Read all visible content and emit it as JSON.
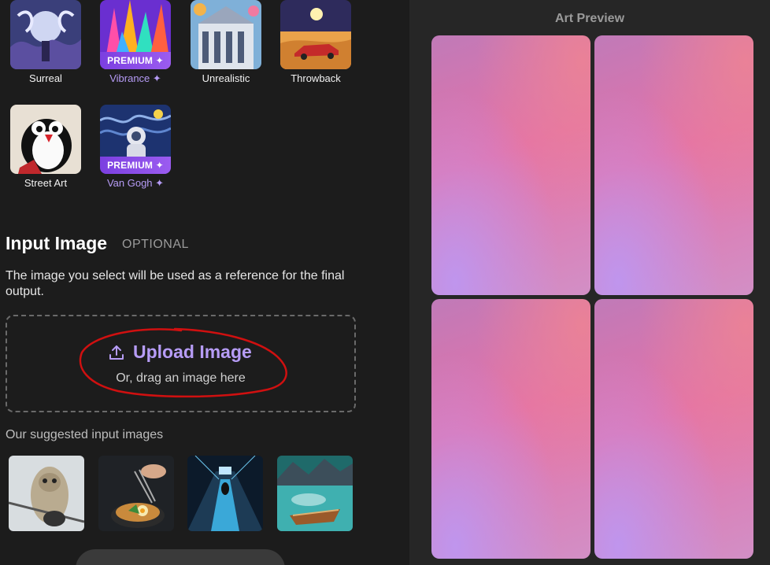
{
  "styles": [
    {
      "label": "Surreal",
      "premium": false,
      "icon": "surreal-art-thumbnail"
    },
    {
      "label": "Vibrance ✦",
      "premium": true,
      "badge": "PREMIUM ✦",
      "icon": "vibrance-art-thumbnail"
    },
    {
      "label": "Unrealistic",
      "premium": false,
      "icon": "unrealistic-art-thumbnail"
    },
    {
      "label": "Throwback",
      "premium": false,
      "icon": "throwback-art-thumbnail"
    },
    {
      "label": "Street Art",
      "premium": false,
      "icon": "street-art-thumbnail"
    },
    {
      "label": "Van Gogh ✦",
      "premium": true,
      "badge": "PREMIUM ✦",
      "icon": "van-gogh-art-thumbnail"
    }
  ],
  "input": {
    "title": "Input Image",
    "optional": "OPTIONAL",
    "description": "The image you select will be used as a reference for the final output.",
    "upload_label": "Upload Image",
    "upload_sub": "Or, drag an image here",
    "upload_icon": "upload-icon"
  },
  "suggested": {
    "title": "Our suggested input images",
    "items": [
      "owl-photo",
      "ramen-chopsticks-photo",
      "escalator-tunnel-photo",
      "boat-lake-photo"
    ]
  },
  "preview": {
    "title": "Art Preview"
  },
  "colors": {
    "accent": "#b69cf6",
    "premium": "#8a4ee8",
    "annotation": "#d01010"
  }
}
